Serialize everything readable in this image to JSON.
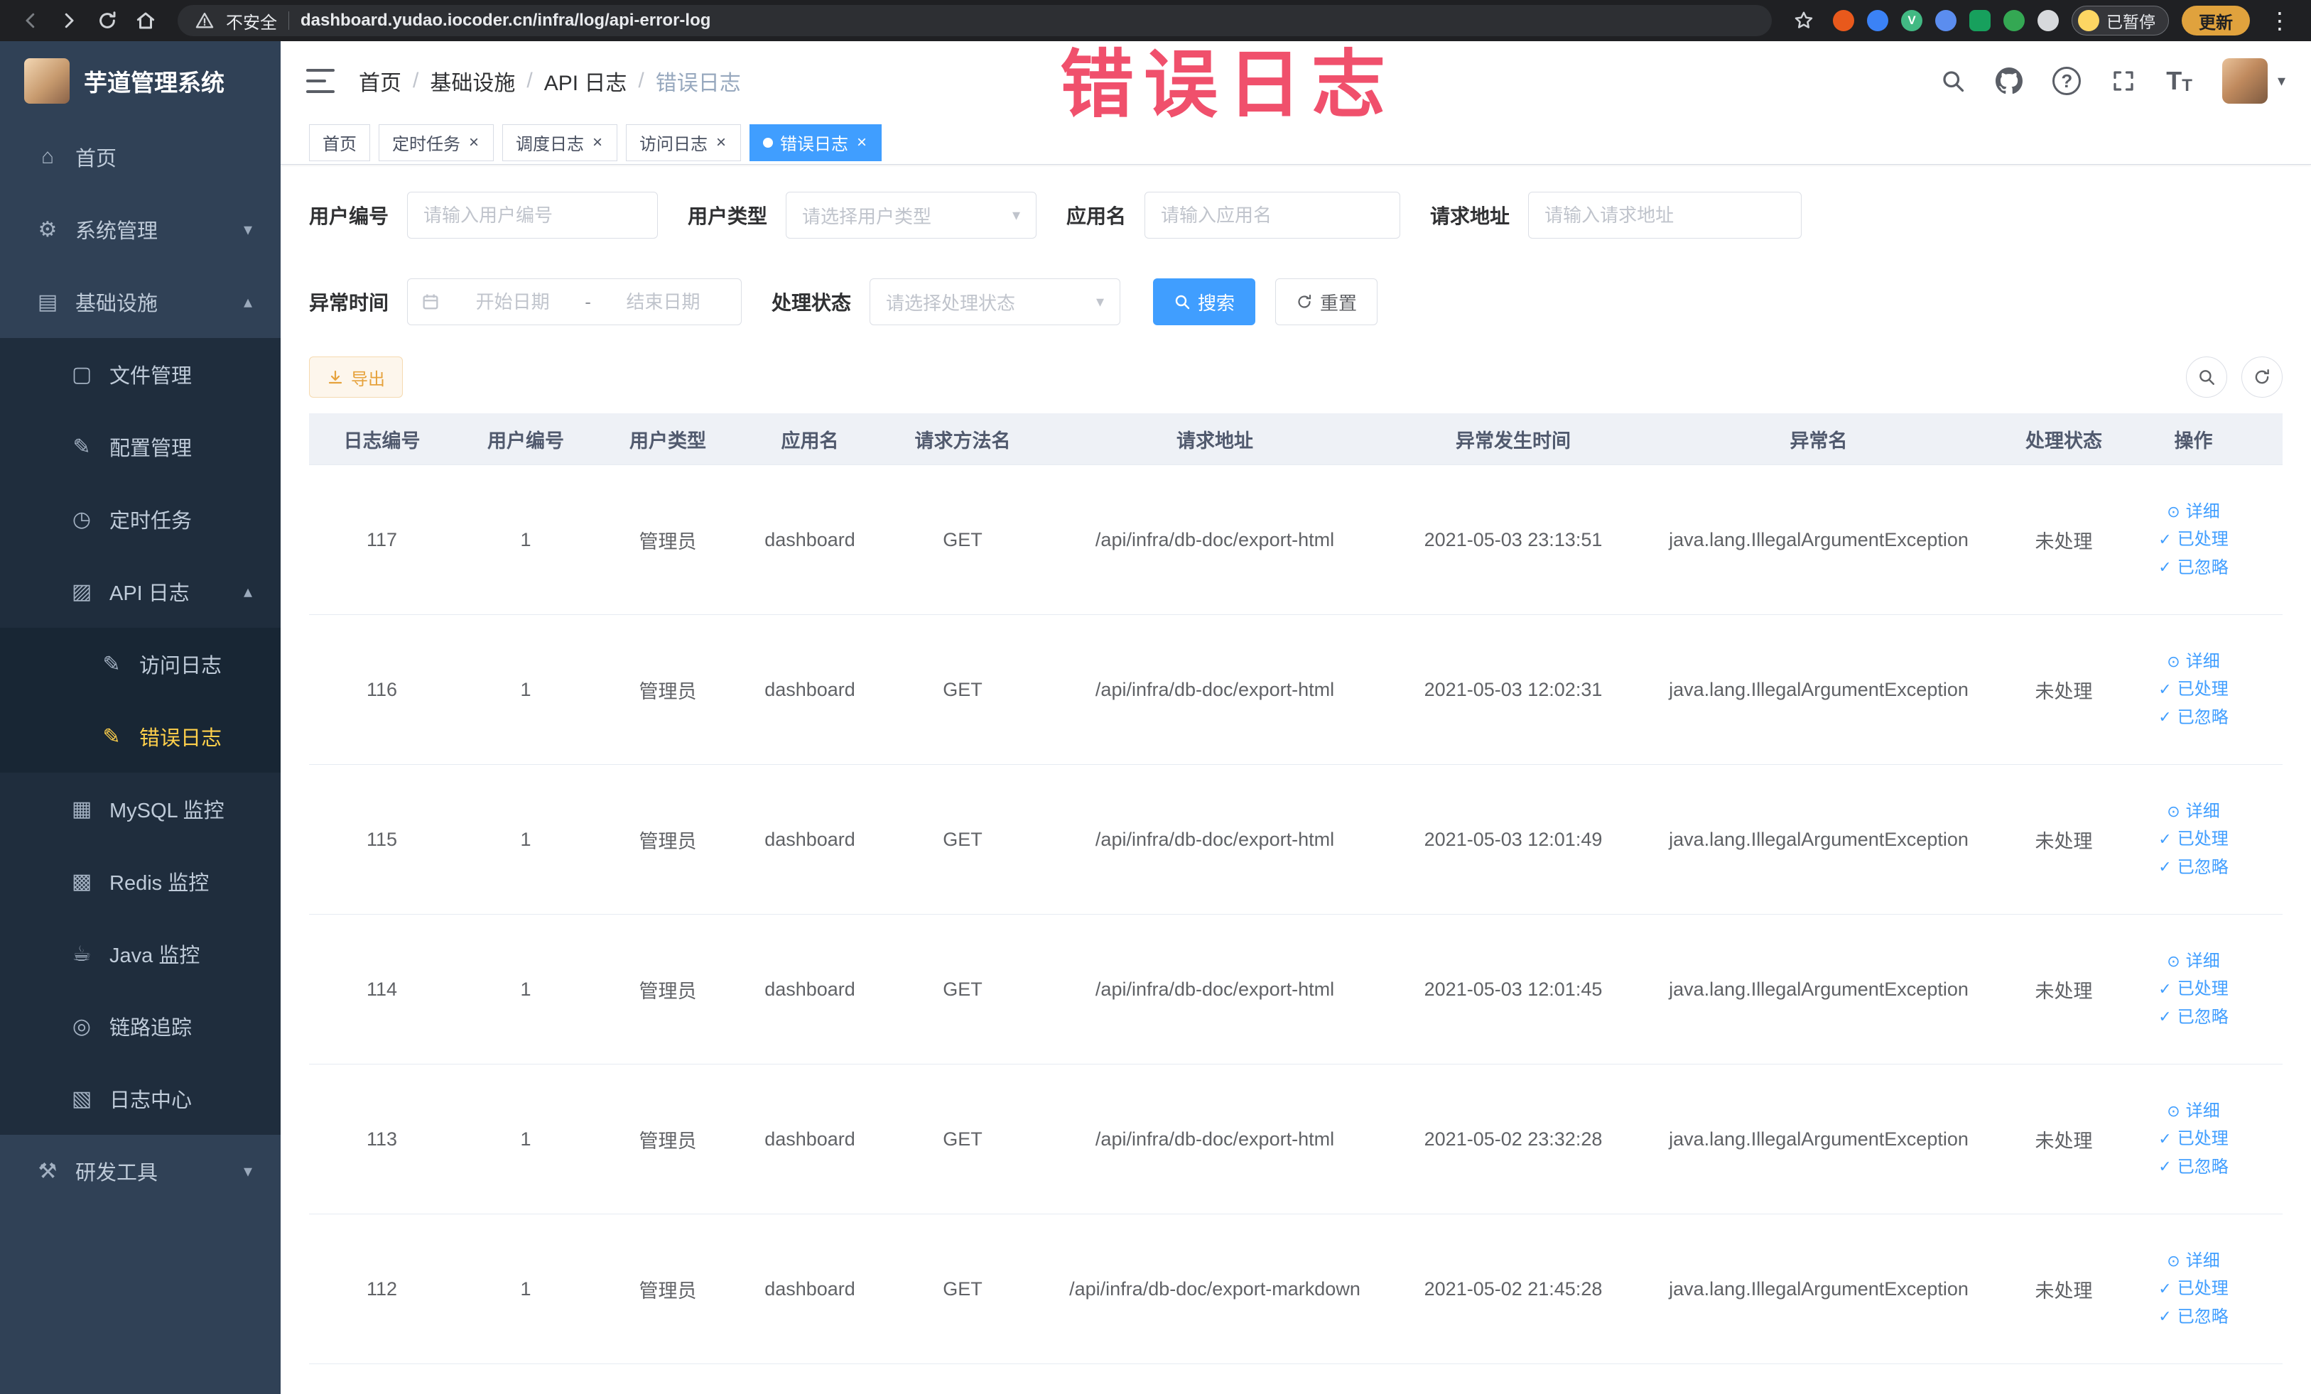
{
  "colors": {
    "primary": "#409eff",
    "menu_active": "#ffd04b",
    "annotation": "#f0506c",
    "warning": "#e6a23c"
  },
  "browser": {
    "security_label": "不安全",
    "url": "dashboard.yudao.iocoder.cn/infra/log/api-error-log",
    "paused_badge": "已暂停",
    "update_button": "更新"
  },
  "annotation": {
    "text": "错误日志"
  },
  "sidebar": {
    "title": "芋道管理系统",
    "menu": [
      {
        "label": "首页",
        "icon": "home-icon",
        "slug": "home",
        "level": 0
      },
      {
        "label": "系统管理",
        "icon": "gear-icon",
        "slug": "system",
        "level": 0,
        "chevron": "down"
      },
      {
        "label": "基础设施",
        "icon": "infrastructure-icon",
        "slug": "infrastructure",
        "level": 0,
        "chevron": "up"
      },
      {
        "label": "文件管理",
        "icon": "file-icon",
        "slug": "file-manage",
        "level": 1
      },
      {
        "label": "配置管理",
        "icon": "config-icon",
        "slug": "config-manage",
        "level": 1
      },
      {
        "label": "定时任务",
        "icon": "timer-icon",
        "slug": "scheduled-jobs",
        "level": 1
      },
      {
        "label": "API 日志",
        "icon": "api-log-icon",
        "slug": "api-log",
        "level": 1,
        "chevron": "up"
      },
      {
        "label": "访问日志",
        "icon": "access-log-icon",
        "slug": "api-access-log",
        "level": 2
      },
      {
        "label": "错误日志",
        "icon": "error-log-icon",
        "slug": "api-error-log",
        "level": 2,
        "active": true
      },
      {
        "label": "MySQL 监控",
        "icon": "mysql-icon",
        "slug": "mysql-monitor",
        "level": 1
      },
      {
        "label": "Redis 监控",
        "icon": "redis-icon",
        "slug": "redis-monitor",
        "level": 1
      },
      {
        "label": "Java 监控",
        "icon": "java-icon",
        "slug": "java-monitor",
        "level": 1
      },
      {
        "label": "链路追踪",
        "icon": "trace-icon",
        "slug": "link-trace",
        "level": 1
      },
      {
        "label": "日志中心",
        "icon": "log-center-icon",
        "slug": "log-center",
        "level": 1
      },
      {
        "label": "研发工具",
        "icon": "tools-icon",
        "slug": "dev-tools",
        "level": 0,
        "chevron": "down"
      }
    ]
  },
  "header": {
    "breadcrumb": [
      "首页",
      "基础设施",
      "API 日志",
      "错误日志"
    ],
    "separator": "/"
  },
  "tabs": [
    {
      "label": "首页",
      "slug": "home",
      "closable": false,
      "active": false
    },
    {
      "label": "定时任务",
      "slug": "scheduled-jobs",
      "closable": true,
      "active": false
    },
    {
      "label": "调度日志",
      "slug": "schedule-log",
      "closable": true,
      "active": false
    },
    {
      "label": "访问日志",
      "slug": "api-access-log",
      "closable": true,
      "active": false
    },
    {
      "label": "错误日志",
      "slug": "api-error-log",
      "closable": true,
      "active": true
    }
  ],
  "filters": {
    "user_id_label": "用户编号",
    "user_id_placeholder": "请输入用户编号",
    "user_type_label": "用户类型",
    "user_type_placeholder": "请选择用户类型",
    "app_name_label": "应用名",
    "app_name_placeholder": "请输入应用名",
    "request_url_label": "请求地址",
    "request_url_placeholder": "请输入请求地址",
    "time_label": "异常时间",
    "time_start_placeholder": "开始日期",
    "time_separator": "-",
    "time_end_placeholder": "结束日期",
    "status_label": "处理状态",
    "status_placeholder": "请选择处理状态",
    "search_label": "搜索",
    "reset_label": "重置"
  },
  "toolbar": {
    "export_label": "导出"
  },
  "table": {
    "columns": [
      "日志编号",
      "用户编号",
      "用户类型",
      "应用名",
      "请求方法名",
      "请求地址",
      "异常发生时间",
      "异常名",
      "处理状态",
      "操作"
    ],
    "rows": [
      [
        "117",
        "1",
        "管理员",
        "dashboard",
        "GET",
        "/api/infra/db-doc/export-html",
        "2021-05-03 23:13:51",
        "java.lang.IllegalArgumentException",
        "未处理"
      ],
      [
        "116",
        "1",
        "管理员",
        "dashboard",
        "GET",
        "/api/infra/db-doc/export-html",
        "2021-05-03 12:02:31",
        "java.lang.IllegalArgumentException",
        "未处理"
      ],
      [
        "115",
        "1",
        "管理员",
        "dashboard",
        "GET",
        "/api/infra/db-doc/export-html",
        "2021-05-03 12:01:49",
        "java.lang.IllegalArgumentException",
        "未处理"
      ],
      [
        "114",
        "1",
        "管理员",
        "dashboard",
        "GET",
        "/api/infra/db-doc/export-html",
        "2021-05-03 12:01:45",
        "java.lang.IllegalArgumentException",
        "未处理"
      ],
      [
        "113",
        "1",
        "管理员",
        "dashboard",
        "GET",
        "/api/infra/db-doc/export-html",
        "2021-05-02 23:32:28",
        "java.lang.IllegalArgumentException",
        "未处理"
      ],
      [
        "112",
        "1",
        "管理员",
        "dashboard",
        "GET",
        "/api/infra/db-doc/export-markdown",
        "2021-05-02 21:45:28",
        "java.lang.IllegalArgumentException",
        "未处理"
      ]
    ],
    "actions": [
      {
        "label": "详细",
        "icon": "eye-icon",
        "slug": "detail"
      },
      {
        "label": "已处理",
        "icon": "check-icon",
        "slug": "processed"
      },
      {
        "label": "已忽略",
        "icon": "check-icon",
        "slug": "ignored"
      }
    ]
  }
}
